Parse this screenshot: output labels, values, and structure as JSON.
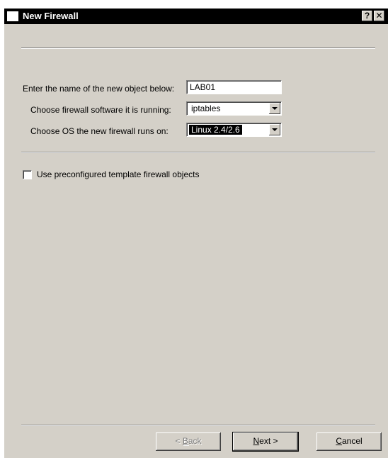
{
  "window": {
    "title": "New Firewall",
    "help_glyph": "?",
    "close_glyph": "✕"
  },
  "form": {
    "name_label": "Enter the name of the new object below:",
    "name_value": "LAB01",
    "software_label": "Choose firewall software it is running:",
    "software_value": "iptables",
    "os_label": "Choose OS the new firewall runs on:",
    "os_value": "Linux 2.4/2.6",
    "template_label": "Use preconfigured template firewall objects",
    "template_checked": false
  },
  "buttons": {
    "back_mnemonic": "B",
    "back_rest": "ack",
    "back_prefix": "< ",
    "next_mnemonic": "N",
    "next_rest": "ext >",
    "cancel_mnemonic": "C",
    "cancel_rest": "ancel"
  }
}
